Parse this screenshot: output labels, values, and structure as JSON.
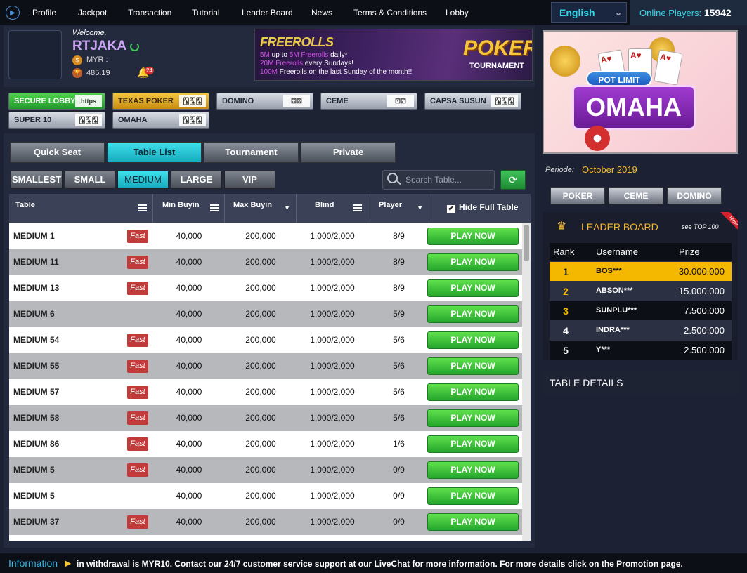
{
  "nav": {
    "items": [
      "Profile",
      "Jackpot",
      "Transaction",
      "Tutorial",
      "Leader Board",
      "News",
      "Terms & Conditions",
      "Lobby"
    ],
    "language": "English",
    "online_label": "Online Players:",
    "online_count": "15942"
  },
  "user": {
    "welcome": "Welcome,",
    "username": "RTJAKA",
    "currency": "MYR :",
    "points": "485.19",
    "notifications": "24"
  },
  "banner": {
    "title": "FREEROLLS",
    "line1_a": "5M",
    "line1_b": " up to ",
    "line1_c": "5M Freerolls",
    "line1_d": " daily*",
    "line2_a": "20M Freerolls",
    "line2_b": " every Sundays!",
    "line3_a": "100M",
    "line3_b": " Freerolls on the last Sunday of the month!!",
    "poker": "POKER",
    "tournament": "TOURNAMENT"
  },
  "game_tabs": [
    {
      "label": "SECURE LOBBY",
      "icon": "https"
    },
    {
      "label": "TEXAS POKER",
      "icon": "10 J Q"
    },
    {
      "label": "DOMINO",
      "icon": "domino"
    },
    {
      "label": "CEME",
      "icon": "dice"
    },
    {
      "label": "CAPSA SUSUN",
      "icon": "cards"
    },
    {
      "label": "SUPER 10",
      "icon": "cards"
    },
    {
      "label": "OMAHA",
      "icon": "cards"
    }
  ],
  "mode_tabs": [
    "Quick Seat",
    "Table List",
    "Tournament",
    "Private"
  ],
  "size_tabs": [
    "SMALLEST",
    "SMALL",
    "MEDIUM",
    "LARGE",
    "VIP"
  ],
  "search": {
    "placeholder": "Search Table..."
  },
  "table": {
    "headers": [
      "Table",
      "Min Buyin",
      "Max Buyin",
      "Blind",
      "Player"
    ],
    "hide_full": "Hide Full Table",
    "fast_label": "Fast",
    "play_label": "PLAY NOW",
    "rows": [
      {
        "name": "MEDIUM 1",
        "fast": true,
        "min": "40,000",
        "max": "200,000",
        "blind": "1,000/2,000",
        "player": "8/9"
      },
      {
        "name": "MEDIUM 11",
        "fast": true,
        "min": "40,000",
        "max": "200,000",
        "blind": "1,000/2,000",
        "player": "8/9"
      },
      {
        "name": "MEDIUM 13",
        "fast": true,
        "min": "40,000",
        "max": "200,000",
        "blind": "1,000/2,000",
        "player": "8/9"
      },
      {
        "name": "MEDIUM 6",
        "fast": false,
        "min": "40,000",
        "max": "200,000",
        "blind": "1,000/2,000",
        "player": "5/9"
      },
      {
        "name": "MEDIUM 54",
        "fast": true,
        "min": "40,000",
        "max": "200,000",
        "blind": "1,000/2,000",
        "player": "5/6"
      },
      {
        "name": "MEDIUM 55",
        "fast": true,
        "min": "40,000",
        "max": "200,000",
        "blind": "1,000/2,000",
        "player": "5/6"
      },
      {
        "name": "MEDIUM 57",
        "fast": true,
        "min": "40,000",
        "max": "200,000",
        "blind": "1,000/2,000",
        "player": "5/6"
      },
      {
        "name": "MEDIUM 58",
        "fast": true,
        "min": "40,000",
        "max": "200,000",
        "blind": "1,000/2,000",
        "player": "5/6"
      },
      {
        "name": "MEDIUM 86",
        "fast": true,
        "min": "40,000",
        "max": "200,000",
        "blind": "1,000/2,000",
        "player": "1/6"
      },
      {
        "name": "MEDIUM 5",
        "fast": true,
        "min": "40,000",
        "max": "200,000",
        "blind": "1,000/2,000",
        "player": "0/9"
      },
      {
        "name": "MEDIUM 5",
        "fast": false,
        "min": "40,000",
        "max": "200,000",
        "blind": "1,000/2,000",
        "player": "0/9"
      },
      {
        "name": "MEDIUM 37",
        "fast": true,
        "min": "40,000",
        "max": "200,000",
        "blind": "1,000/2,000",
        "player": "0/9"
      }
    ]
  },
  "promo": {
    "pot_limit": "POT LIMIT",
    "omaha": "OMAHA"
  },
  "periode": {
    "label": "Periode:",
    "value": "October 2019"
  },
  "right_tabs": [
    "POKER",
    "CEME",
    "DOMINO"
  ],
  "leaderboard": {
    "title": "LEADER BOARD",
    "see_top": "see TOP 100",
    "new_label": "New",
    "headers": [
      "Rank",
      "Username",
      "Prize"
    ],
    "rows": [
      {
        "rank": "1",
        "user": "BOS***",
        "prize": "30.000.000"
      },
      {
        "rank": "2",
        "user": "ABSON***",
        "prize": "15.000.000"
      },
      {
        "rank": "3",
        "user": "SUNPLU***",
        "prize": "7.500.000"
      },
      {
        "rank": "4",
        "user": "INDRA***",
        "prize": "2.500.000"
      },
      {
        "rank": "5",
        "user": "Y***",
        "prize": "2.500.000"
      }
    ]
  },
  "table_details": "TABLE DETAILS",
  "info": {
    "label": "Information",
    "text": "in withdrawal is MYR10. Contact our 24/7 customer service support at our LiveChat for more information. For more details click on the Promotion page."
  },
  "colors": {
    "accent": "#2fd8e6",
    "gold": "#f5b800",
    "play": "#3fc43f",
    "fast": "#c23b3b"
  }
}
